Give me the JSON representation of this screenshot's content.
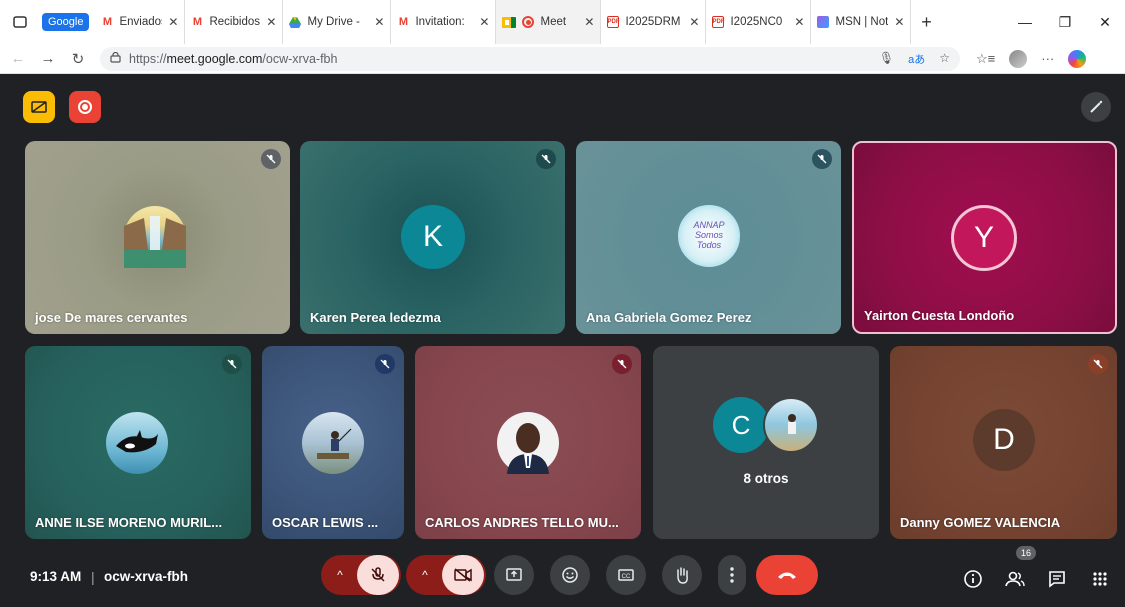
{
  "browser": {
    "tab_group": "Google",
    "tabs": [
      {
        "title": "Enviados -",
        "icon": "gmail-icon"
      },
      {
        "title": "Recibidos -",
        "icon": "gmail-icon"
      },
      {
        "title": "My Drive -",
        "icon": "drive-icon"
      },
      {
        "title": "Invitation:",
        "icon": "gmail-icon"
      },
      {
        "title": "Meet",
        "icon": "meet-icon"
      },
      {
        "title": "I2025DRM",
        "icon": "pdf-icon"
      },
      {
        "title": "I2025NC0",
        "icon": "pdf-icon"
      },
      {
        "title": "MSN | Not",
        "icon": "msn-icon"
      }
    ],
    "url_prefix": "https://",
    "url_domain": "meet.google.com",
    "url_path": "/ocw-xrva-fbh"
  },
  "participants": [
    {
      "name": "jose De mares cervantes",
      "avatar": "waterfall-photo"
    },
    {
      "name": "Karen Perea ledezma",
      "initial": "K"
    },
    {
      "name": "Ana Gabriela Gomez Perez",
      "avatar": "logo-photo",
      "logo_text": "ANNAP Somos Todos"
    },
    {
      "name": "Yairton Cuesta Londoño",
      "initial": "Y"
    },
    {
      "name": "ANNE ILSE MORENO MURIL...",
      "avatar": "orca-photo"
    },
    {
      "name": "OSCAR LEWIS ...",
      "avatar": "beach-photo"
    },
    {
      "name": "CARLOS ANDRES TELLO MU...",
      "avatar": "portrait-photo"
    },
    {
      "name": "8 otros",
      "initial": "C"
    },
    {
      "name": "Danny GOMEZ VALENCIA",
      "initial": "D"
    }
  ],
  "meeting": {
    "time": "9:13 AM",
    "code": "ocw-xrva-fbh",
    "people_count": "16"
  },
  "colors": {
    "background": "#202124",
    "end_call": "#ea4335",
    "muted_button": "#f9dedc"
  }
}
